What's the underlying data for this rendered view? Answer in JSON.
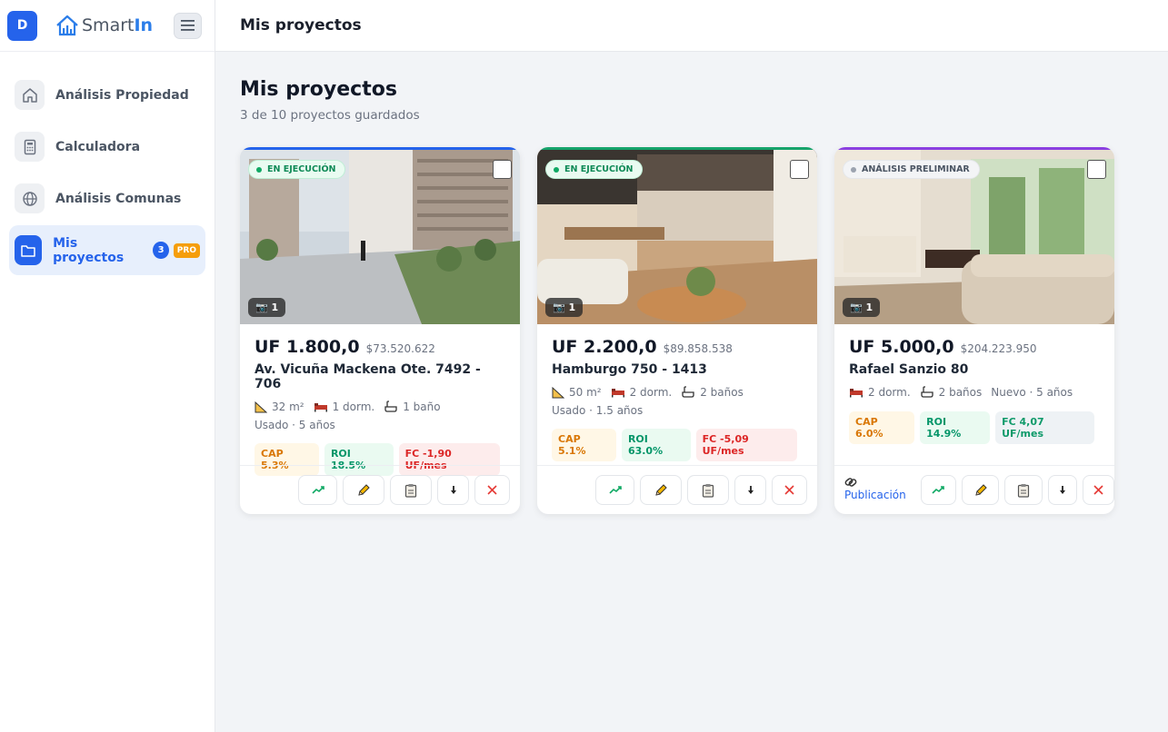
{
  "app": {
    "avatar_initial": "D",
    "logo_part1": "Smart",
    "logo_part2": "In"
  },
  "sidebar": {
    "items": [
      {
        "label": "Análisis Propiedad",
        "icon": "home-icon"
      },
      {
        "label": "Calculadora",
        "icon": "calculator-icon"
      },
      {
        "label": "Análisis Comunas",
        "icon": "globe-icon"
      },
      {
        "label": "Mis proyectos",
        "icon": "folder-icon",
        "count": "3",
        "badge": "PRO",
        "active": true
      }
    ]
  },
  "topbar": {
    "title": "Mis proyectos"
  },
  "main": {
    "title": "Mis proyectos",
    "subtitle": "3 de 10 proyectos guardados"
  },
  "cards": [
    {
      "status": "EN EJECUCIÓN",
      "photos": "📷 1",
      "price_uf": "UF 1.800,0",
      "price_clp": "$73.520.622",
      "address": "Av. Vicuña Mackena Ote. 7492 - 706",
      "area": "32 m²",
      "bedrooms": "1 dorm.",
      "bathrooms": "1 baño",
      "condition": "Usado · 5 años",
      "cap": "CAP 5.3%",
      "roi": "ROI 18.5%",
      "fc": "FC -1,90 UF/mes"
    },
    {
      "status": "EN EJECUCIÓN",
      "photos": "📷 1",
      "price_uf": "UF 2.200,0",
      "price_clp": "$89.858.538",
      "address": "Hamburgo 750 - 1413",
      "area": "50 m²",
      "bedrooms": "2 dorm.",
      "bathrooms": "2 baños",
      "condition": "Usado · 1.5 años",
      "cap": "CAP 5.1%",
      "roi": "ROI 63.0%",
      "fc": "FC -5,09 UF/mes"
    },
    {
      "status": "ANÁLISIS PRELIMINAR",
      "photos": "📷 1",
      "price_uf": "UF 5.000,0",
      "price_clp": "$204.223.950",
      "address": "Rafael Sanzio 80",
      "bedrooms": "2 dorm.",
      "bathrooms": "2 baños",
      "condition": "Nuevo · 5 años",
      "cap": "CAP 6.0%",
      "roi": "ROI 14.9%",
      "fc": "FC 4,07 UF/mes",
      "publication": "Publicación"
    }
  ],
  "colors": {
    "primary": "#2563eb",
    "card1_accent": "#2563eb",
    "card2_accent": "#16a36b",
    "card3_accent": "#8b3fe0"
  }
}
